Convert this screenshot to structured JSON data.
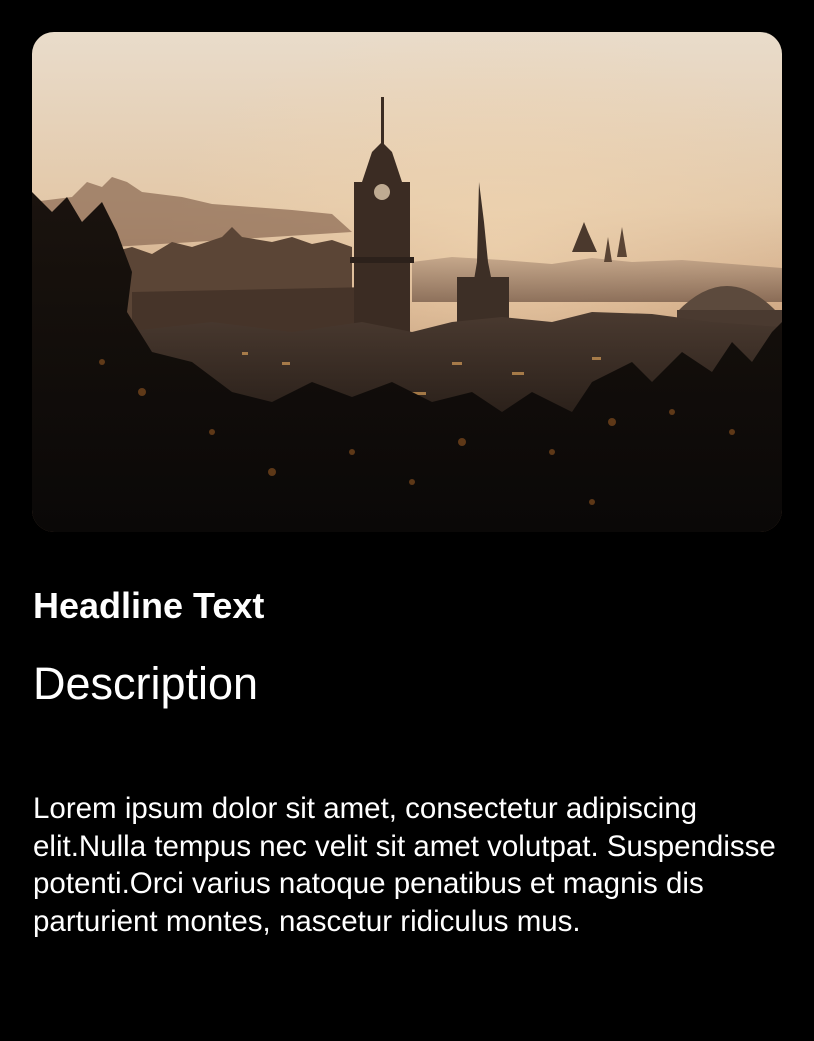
{
  "card": {
    "image": {
      "subject": "city-skyline-sunset-photo",
      "colors": {
        "sky_top": "#e6d7c4",
        "sky_horizon": "#d8b48e",
        "haze": "#b9977a",
        "buildings": "#3b2e26",
        "foliage": "#140f0b",
        "glow": "#b8742c"
      }
    },
    "headline": "Headline Text",
    "description": "Description",
    "body": "Lorem ipsum dolor sit amet, consectetur adipiscing elit.Nulla tempus nec velit sit amet volutpat. Suspendisse potenti.Orci varius natoque penatibus et magnis dis parturient montes, nascetur ridiculus mus.",
    "colors": {
      "background": "#000000",
      "text": "#ffffff"
    }
  }
}
